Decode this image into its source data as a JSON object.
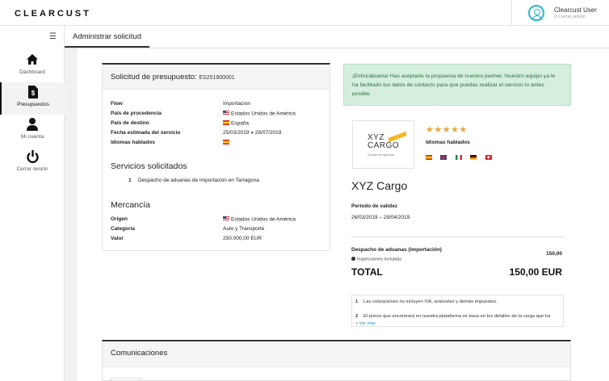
{
  "header": {
    "logo": "CLEARCUST",
    "user_name": "Clearcust User",
    "logout": "Cerrar sesión"
  },
  "sidebar": {
    "menu_icon": "hamburger-icon",
    "items": [
      {
        "label": "Dashboard",
        "icon": "home-icon",
        "active": false
      },
      {
        "label": "Presupuestos",
        "icon": "invoice-dollar-icon",
        "active": true
      },
      {
        "label": "Mi cuenta",
        "icon": "user-icon",
        "active": false
      },
      {
        "label": "Cerrar sesión",
        "icon": "power-icon",
        "active": false
      }
    ]
  },
  "page": {
    "title": "Administrar solicitud"
  },
  "request": {
    "title": "Solicitud de presupuesto:",
    "id": "ES201900001",
    "fields": [
      {
        "label": "Flow",
        "value": "Importación",
        "flag": ""
      },
      {
        "label": "País de procedencia",
        "value": "Estados Unidos de América",
        "flag": "us"
      },
      {
        "label": "País de destino",
        "value": "España",
        "flag": "es"
      },
      {
        "label": "Fecha estimada del servicio",
        "value": "25/03/2019",
        "value2": "29/07/2019",
        "flag": ""
      },
      {
        "label": "Idiomas hablados",
        "value": "",
        "flag": "es"
      }
    ],
    "services_title": "Servicios solicitados",
    "services": [
      {
        "num": "1",
        "text": "Despacho de aduanas de Importación en Tarragona"
      }
    ],
    "goods_title": "Mercancía",
    "goods": [
      {
        "label": "Origen",
        "value": "Estados Unidos de América",
        "flag": "us"
      },
      {
        "label": "Categoría",
        "value": "Auto y Transporte",
        "flag": ""
      },
      {
        "label": "Valor",
        "value": "250.000,00 EUR",
        "flag": ""
      }
    ]
  },
  "alert": {
    "text": "¡Enhorabuena! Has aceptado la propuesta de nuestro partner. Nuestro equipo ya le ha facilitado tus datos de contacto para que puedas realizar el servicio lo antes posible.",
    "color": "#d4efdd"
  },
  "partner": {
    "logo_text_1": "XYZ",
    "logo_text_2": "CARGO",
    "logo_tagline": "Choose the right way",
    "rating": 4.5,
    "stars_display": "★★★★★",
    "languages_label": "Idiomas hablados",
    "languages": [
      "es",
      "gb",
      "it",
      "de",
      "ch"
    ],
    "name": "XYZ Cargo",
    "validity_label": "Periodo de validez",
    "validity_value": "26/03/2019 – 29/04/2019",
    "fee_label": "Despacho de aduanas (importación)",
    "fee_value": "150,00",
    "fee_note": "Inspecciones incluidas",
    "total_label": "TOTAL",
    "total_value": "150,00 EUR",
    "notes": [
      {
        "num": "1",
        "text": "Las cotizaciones no incluyen IVA, aranceles y demás impuestos."
      },
      {
        "num": "2",
        "text": "El precio que encontrará en nuestra plataforma se basa en los detalles de la carga que ha"
      }
    ],
    "see_more": "+ Ver más"
  },
  "communications": {
    "title": "Comunicaciones"
  },
  "colors": {
    "accent": "#2ab7cf",
    "star": "#e9a43a",
    "link": "#2a8fc3"
  }
}
